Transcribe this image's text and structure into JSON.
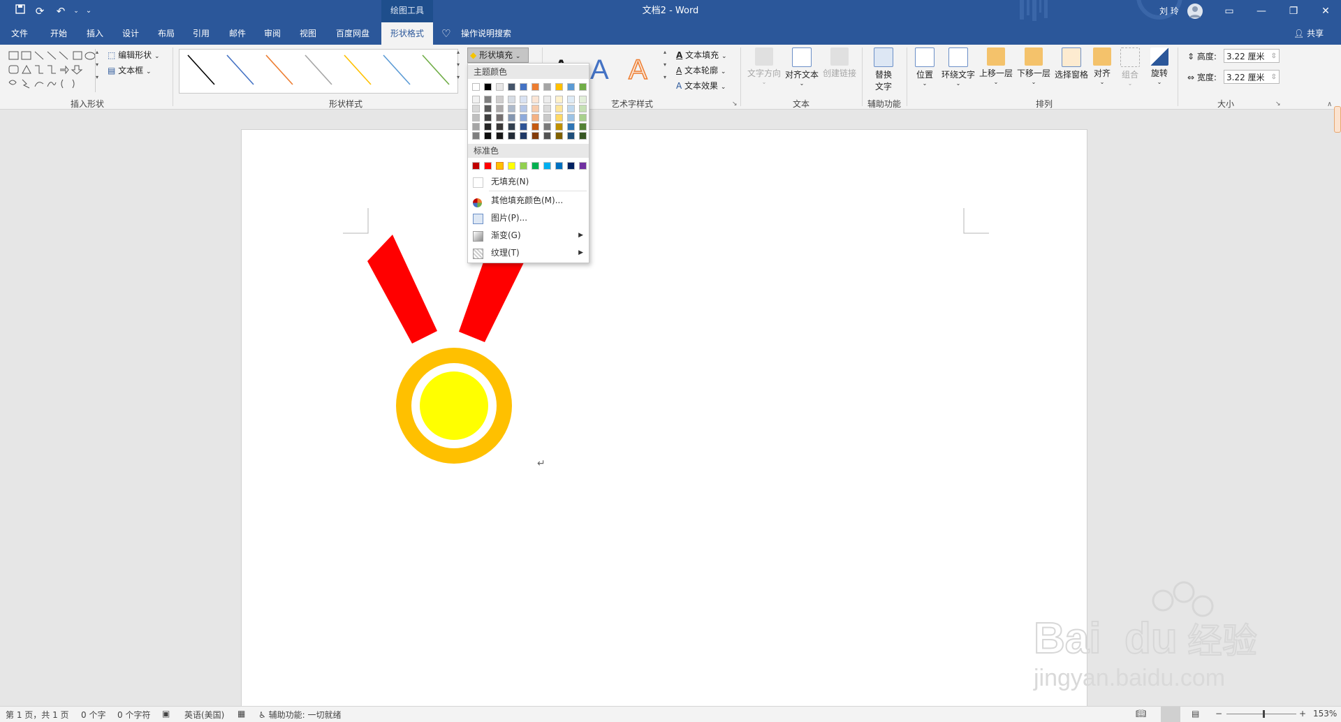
{
  "window": {
    "title": "文档2 - Word",
    "context_tab_header": "绘图工具",
    "user": "刘 玲",
    "share": "共享",
    "tell_me": "操作说明搜索"
  },
  "tabs": [
    "文件",
    "开始",
    "插入",
    "设计",
    "布局",
    "引用",
    "邮件",
    "审阅",
    "视图",
    "百度网盘",
    "形状格式"
  ],
  "ribbon": {
    "insert_shapes": {
      "label": "插入形状",
      "edit_shape": "编辑形状",
      "textbox": "文本框"
    },
    "shape_styles": {
      "label": "形状样式",
      "fill": "形状填充"
    },
    "wordart": {
      "label": "艺术字样式",
      "text_fill": "文本填充",
      "text_outline": "文本轮廓",
      "text_effect": "文本效果",
      "letter": "A"
    },
    "text": {
      "label": "文本",
      "direction": "文字方向",
      "align": "对齐文本",
      "link": "创建链接"
    },
    "accessibility": {
      "label": "辅助功能",
      "alt_text_1": "替换",
      "alt_text_2": "文字"
    },
    "arrange": {
      "label": "排列",
      "position": "位置",
      "wrap": "环绕文字",
      "forward": "上移一层",
      "backward": "下移一层",
      "pane": "选择窗格",
      "align": "对齐",
      "group": "组合",
      "rotate": "旋转"
    },
    "size": {
      "label": "大小",
      "height_label": "高度:",
      "height": "3.22 厘米",
      "width_label": "宽度:",
      "width": "3.22 厘米"
    }
  },
  "line_styles": [
    "#000000",
    "#4472c4",
    "#ed7d31",
    "#a5a5a5",
    "#ffc000",
    "#5b9bd5",
    "#70ad47"
  ],
  "fill_menu": {
    "theme_header": "主题颜色",
    "theme_top": [
      "#ffffff",
      "#000000",
      "#e7e6e6",
      "#44546a",
      "#4472c4",
      "#ed7d31",
      "#a5a5a5",
      "#ffc000",
      "#5b9bd5",
      "#70ad47"
    ],
    "theme_shades": [
      [
        "#f2f2f2",
        "#7f7f7f",
        "#d0cece",
        "#d6dce4",
        "#d9e2f3",
        "#fbe5d5",
        "#ededed",
        "#fff2cc",
        "#deebf6",
        "#e2efd9"
      ],
      [
        "#d8d8d8",
        "#595959",
        "#aeabab",
        "#adb9ca",
        "#b4c6e7",
        "#f7cbac",
        "#dbdbdb",
        "#fee599",
        "#bdd7ee",
        "#c5e0b3"
      ],
      [
        "#bfbfbf",
        "#3f3f3f",
        "#757070",
        "#8496b0",
        "#8eaadb",
        "#f4b183",
        "#c9c9c9",
        "#ffd965",
        "#9cc3e5",
        "#a8d08d"
      ],
      [
        "#a5a5a5",
        "#262626",
        "#3a3838",
        "#323f4f",
        "#2f5496",
        "#c55a11",
        "#7b7b7b",
        "#bf9000",
        "#2e75b5",
        "#538135"
      ],
      [
        "#7f7f7f",
        "#0c0c0c",
        "#171616",
        "#222a35",
        "#1f3864",
        "#833c0b",
        "#525252",
        "#7f6000",
        "#1e4e79",
        "#375623"
      ]
    ],
    "standard_header": "标准色",
    "standard": [
      "#c00000",
      "#ff0000",
      "#ffc000",
      "#ffff00",
      "#92d050",
      "#00b050",
      "#00b0f0",
      "#0070c0",
      "#002060",
      "#7030a0"
    ],
    "no_fill": "无填充(N)",
    "more_colors": "其他填充颜色(M)...",
    "picture": "图片(P)...",
    "gradient": "渐变(G)",
    "texture": "纹理(T)"
  },
  "status": {
    "page": "第 1 页，共 1 页",
    "words": "0 个字",
    "chars": "0 个字符",
    "lang": "英语(美国)",
    "access": "辅助功能: 一切就绪",
    "zoom": "153%"
  },
  "colors": {
    "titlebar": "#2b579a",
    "ribbon_red": "#ff0000",
    "medal_outer": "#ffc000",
    "medal_inner": "#ffff00"
  }
}
